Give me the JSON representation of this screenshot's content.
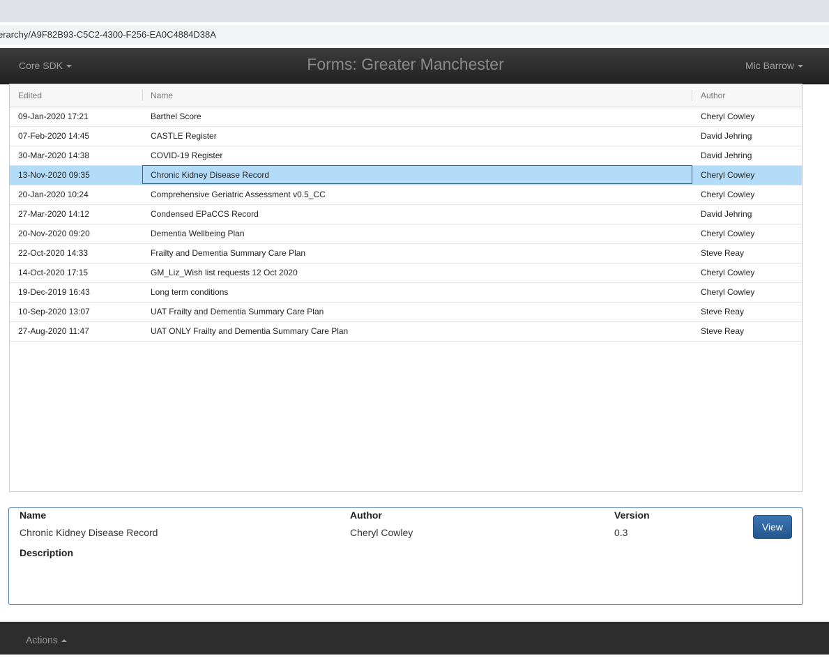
{
  "browser": {
    "url_fragment": "erarchy/A9F82B93-C5C2-4300-F256-EA0C4884D38A"
  },
  "navbar": {
    "left_menu": "Core SDK",
    "title": "Forms: Greater Manchester",
    "user_menu": "Mic Barrow"
  },
  "grid": {
    "columns": {
      "edited": "Edited",
      "name": "Name",
      "author": "Author"
    },
    "rows": [
      {
        "edited": "09-Jan-2020 17:21",
        "name": "Barthel Score",
        "author": "Cheryl Cowley"
      },
      {
        "edited": "07-Feb-2020 14:45",
        "name": "CASTLE Register",
        "author": "David Jehring"
      },
      {
        "edited": "30-Mar-2020 14:38",
        "name": "COVID-19 Register",
        "author": "David Jehring"
      },
      {
        "edited": "13-Nov-2020 09:35",
        "name": "Chronic Kidney Disease Record",
        "author": "Cheryl Cowley"
      },
      {
        "edited": "20-Jan-2020 10:24",
        "name": "Comprehensive Geriatric Assessment v0.5_CC",
        "author": "Cheryl Cowley"
      },
      {
        "edited": "27-Mar-2020 14:12",
        "name": "Condensed EPaCCS Record",
        "author": "David Jehring"
      },
      {
        "edited": "20-Nov-2020 09:20",
        "name": "Dementia Wellbeing Plan",
        "author": "Cheryl Cowley"
      },
      {
        "edited": "22-Oct-2020 14:33",
        "name": "Frailty and Dementia Summary Care Plan",
        "author": "Steve Reay"
      },
      {
        "edited": "14-Oct-2020 17:15",
        "name": "GM_Liz_Wish list requests 12 Oct 2020",
        "author": "Cheryl Cowley"
      },
      {
        "edited": "19-Dec-2019 16:43",
        "name": "Long term conditions",
        "author": "Cheryl Cowley"
      },
      {
        "edited": "10-Sep-2020 13:07",
        "name": "UAT Frailty and Dementia Summary Care Plan",
        "author": "Steve Reay"
      },
      {
        "edited": "27-Aug-2020 11:47",
        "name": "UAT ONLY Frailty and Dementia Summary Care Plan",
        "author": "Steve Reay"
      }
    ],
    "selected_index": 3,
    "selected_color": "#b3dcf8"
  },
  "details": {
    "name_label": "Name",
    "name_value": "Chronic Kidney Disease Record",
    "author_label": "Author",
    "author_value": "Cheryl Cowley",
    "version_label": "Version",
    "version_value": "0.3",
    "description_label": "Description",
    "description_value": "",
    "view_button": "View"
  },
  "footer": {
    "actions_menu": "Actions"
  },
  "icons": {
    "menu_caret": "caret-down-icon",
    "actions_caret": "caret-up-icon"
  }
}
